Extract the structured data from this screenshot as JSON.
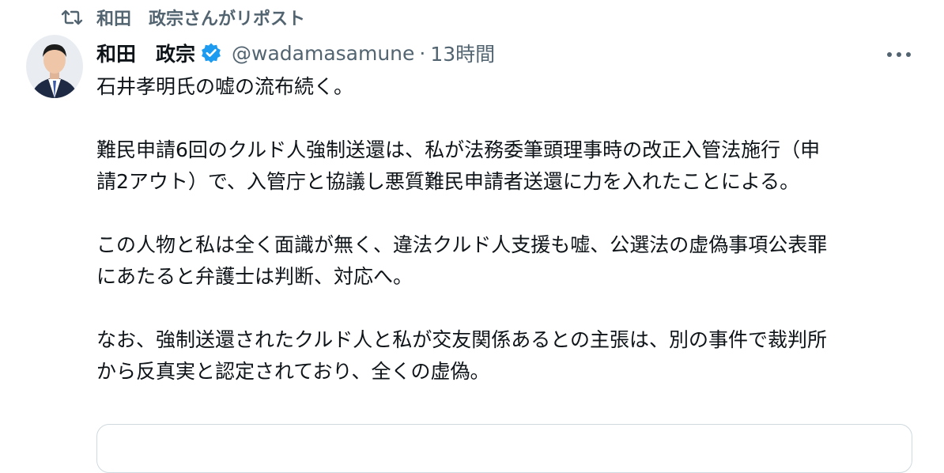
{
  "repost": {
    "icon": "repost-icon",
    "text": "和田　政宗さんがリポスト"
  },
  "author": {
    "name": "和田　政宗",
    "verified_icon": "verified-badge-icon",
    "handle": "@wadamasamune",
    "separator": "·",
    "time": "13時間"
  },
  "menu": {
    "icon": "more-options-icon"
  },
  "post": {
    "paragraphs": [
      [
        "石井孝明氏の嘘の流布続く。"
      ],
      [
        "難民申請6回のクルド人強制送還は、私が法務委筆頭理事時の改正入管法施行（申",
        "請2アウト）で、入管庁と協議し悪質難民申請者送還に力を入れたことによる。"
      ],
      [
        "この人物と私は全く面識が無く、違法クルド人支援も嘘、公選法の虚偽事項公表罪",
        "にあたると弁護士は判断、対応へ。"
      ],
      [
        "なお、強制送還されたクルド人と私が交友関係あるとの主張は、別の事件で裁判所",
        "から反真実と認定されており、全くの虚偽。"
      ]
    ]
  },
  "colors": {
    "text_primary": "#0f1419",
    "text_secondary": "#536471",
    "verified_blue": "#1d9bf0",
    "border": "#cfd9de"
  }
}
